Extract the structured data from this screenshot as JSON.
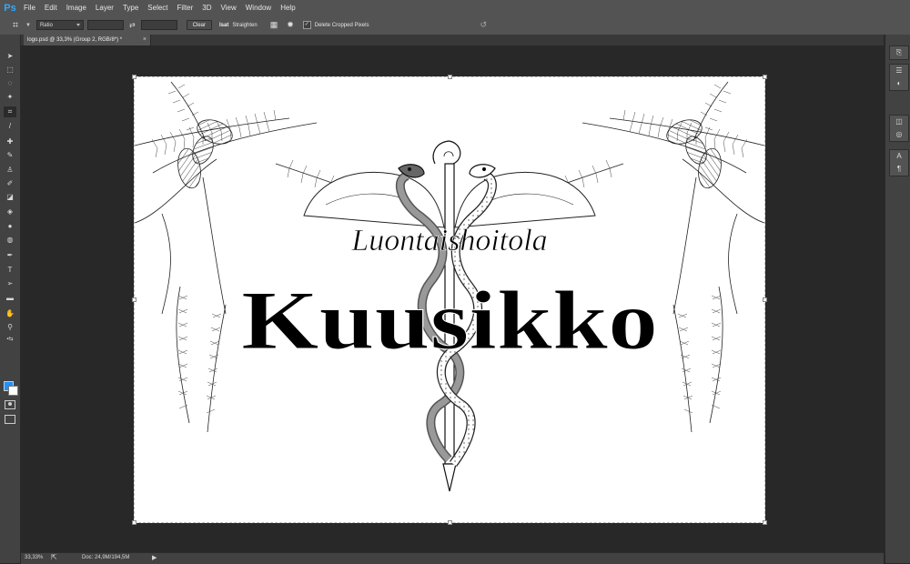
{
  "app": {
    "logo": "Ps"
  },
  "menu": [
    "File",
    "Edit",
    "Image",
    "Layer",
    "Type",
    "Select",
    "Filter",
    "3D",
    "View",
    "Window",
    "Help"
  ],
  "options": {
    "ratio_select": "Ratio",
    "clear_label": "Clear",
    "straighten_icon_text": "Isat",
    "straighten_label": "Straighten",
    "delete_cropped_checked": true,
    "delete_cropped_label": "Delete Cropped Pixels",
    "icons": [
      "crop-icon",
      "swap-icon",
      "grid-overlay-icon",
      "gear-icon",
      "reset-icon"
    ]
  },
  "tools": [
    "move",
    "marquee",
    "lasso",
    "magic-wand",
    "crop",
    "eyedropper",
    "healing-brush",
    "brush",
    "clone-stamp",
    "history-brush",
    "eraser",
    "paint-bucket",
    "blur",
    "dodge",
    "pen",
    "type",
    "path-selection",
    "rectangle",
    "hand",
    "zoom"
  ],
  "colors": {
    "foreground": "#1e90ff",
    "background": "#ffffff",
    "accent": "#31a8ff",
    "ui_dark": "#282828"
  },
  "document": {
    "tab_title": "logo.psd @ 33,3% (Group 2, RGB/8*) *",
    "close_glyph": "×"
  },
  "artwork": {
    "subtitle": "Luontaishoitola",
    "title": "Kuusikko"
  },
  "panels": [
    "history-icon",
    "properties-icon",
    "adjustments-icon",
    "layers-icon",
    "channels-icon",
    "paths-icon",
    "character-icon",
    "paragraph-icon"
  ],
  "status": {
    "zoom": "33,33%",
    "doc_info": "Doc: 24,9M/194,5M",
    "arrow": "▶"
  }
}
